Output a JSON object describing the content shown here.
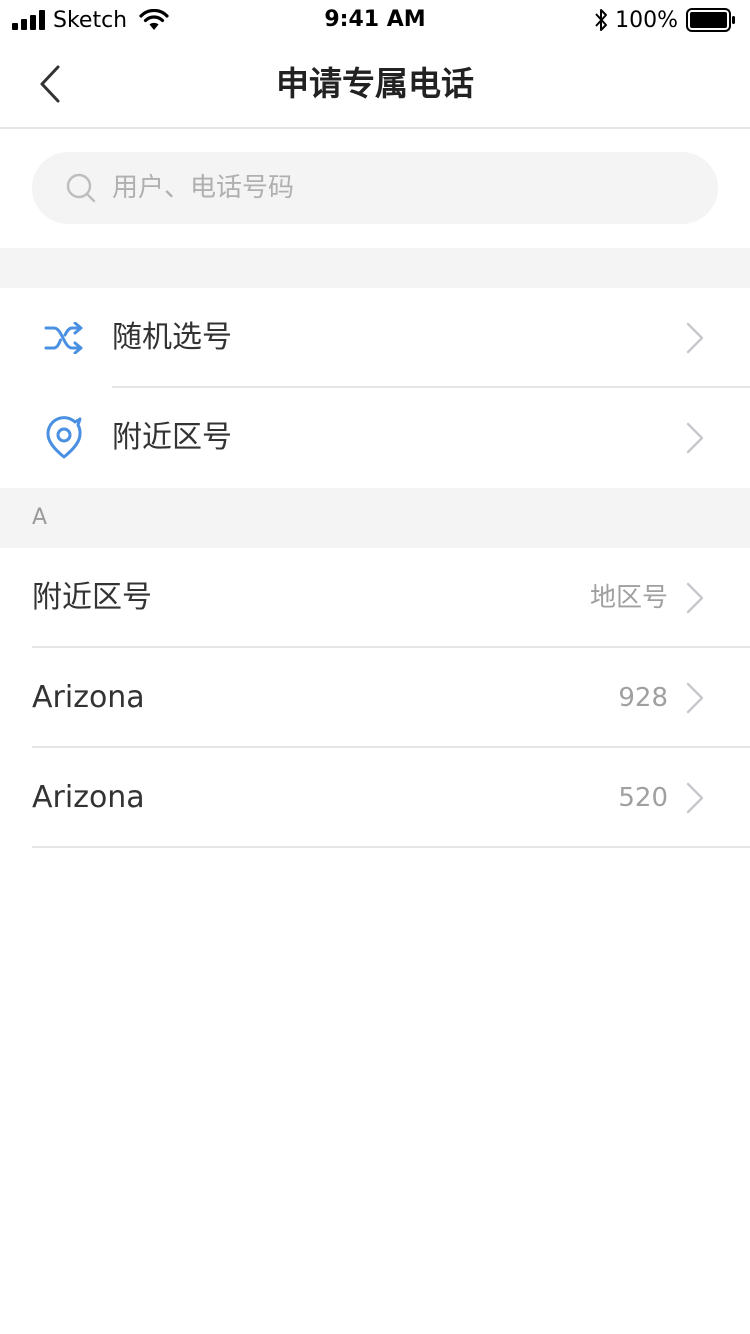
{
  "status_bar": {
    "carrier": "Sketch",
    "time": "9:41 AM",
    "battery": "100%"
  },
  "nav": {
    "title": "申请专属电话"
  },
  "search": {
    "placeholder": "用户、电话号码",
    "value": ""
  },
  "menu": [
    {
      "label": "随机选号",
      "icon": "shuffle-icon"
    },
    {
      "label": "附近区号",
      "icon": "location-icon"
    }
  ],
  "section": {
    "letter": "A"
  },
  "list": [
    {
      "name": "附近区号",
      "value": "地区号"
    },
    {
      "name": "Arizona",
      "value": "928"
    },
    {
      "name": "Arizona",
      "value": "520"
    }
  ],
  "colors": {
    "accent": "#4a90e2",
    "chevron": "#c7c7cc",
    "divider": "#e6e6e6",
    "section_bg": "#f4f4f4"
  }
}
